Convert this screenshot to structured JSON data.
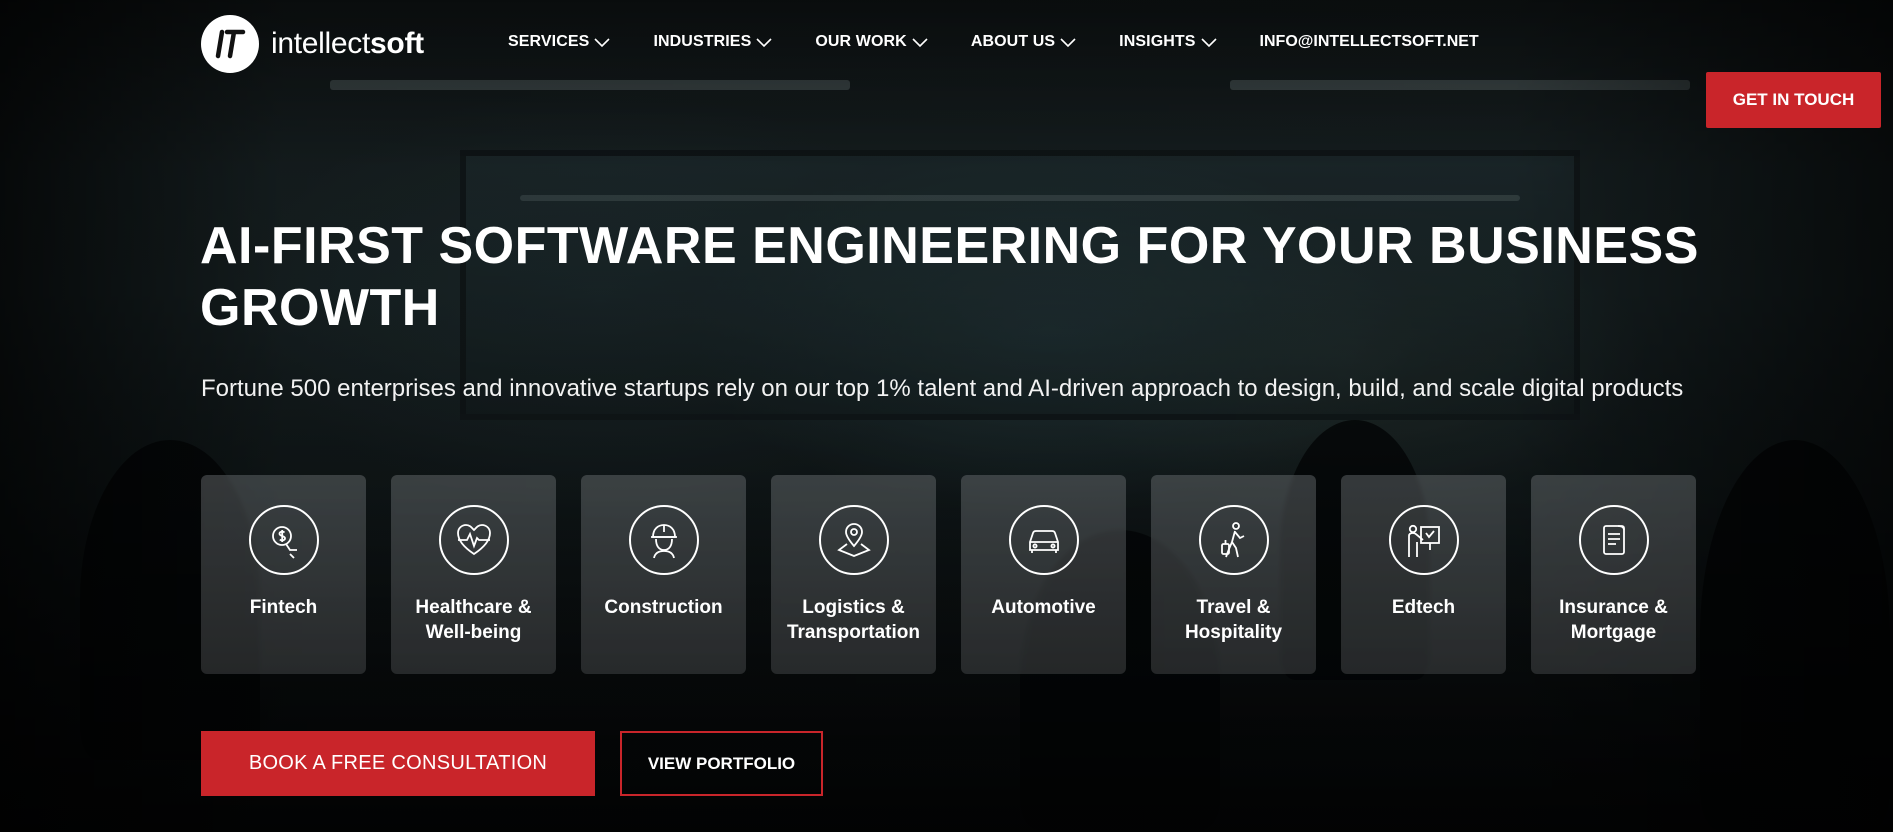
{
  "brand": {
    "name_light": "intellect",
    "name_bold": "soft",
    "accent_color": "#c9252a"
  },
  "nav": {
    "items": [
      {
        "label": "SERVICES",
        "icon": "chevron-down-icon"
      },
      {
        "label": "INDUSTRIES",
        "icon": "chevron-down-icon"
      },
      {
        "label": "OUR WORK",
        "icon": "chevron-down-icon"
      },
      {
        "label": "ABOUT US",
        "icon": "chevron-down-icon"
      },
      {
        "label": "INSIGHTS",
        "icon": "chevron-down-icon"
      }
    ],
    "email": "INFO@INTELLECTSOFT.NET",
    "cta": "GET IN TOUCH"
  },
  "hero": {
    "title": "AI-FIRST SOFTWARE ENGINEERING FOR YOUR BUSINESS GROWTH",
    "subtitle": "Fortune 500 enterprises and innovative startups rely on our top 1% talent and AI-driven approach to design, build, and scale digital products"
  },
  "industries": [
    {
      "line1": "Fintech",
      "line2": "",
      "icon": "dollar-hand-icon"
    },
    {
      "line1": "Healthcare &",
      "line2": "Well-being",
      "icon": "heart-pulse-icon"
    },
    {
      "line1": "Construction",
      "line2": "",
      "icon": "worker-helmet-icon"
    },
    {
      "line1": "Logistics &",
      "line2": "Transportation",
      "icon": "map-pin-icon"
    },
    {
      "line1": "Automotive",
      "line2": "",
      "icon": "car-icon"
    },
    {
      "line1": "Travel &",
      "line2": "Hospitality",
      "icon": "traveler-luggage-icon"
    },
    {
      "line1": "Edtech",
      "line2": "",
      "icon": "teacher-board-icon"
    },
    {
      "line1": "Insurance &",
      "line2": "Mortgage",
      "icon": "document-icon"
    }
  ],
  "actions": {
    "primary": "BOOK A FREE CONSULTATION",
    "secondary": "VIEW PORTFOLIO"
  }
}
